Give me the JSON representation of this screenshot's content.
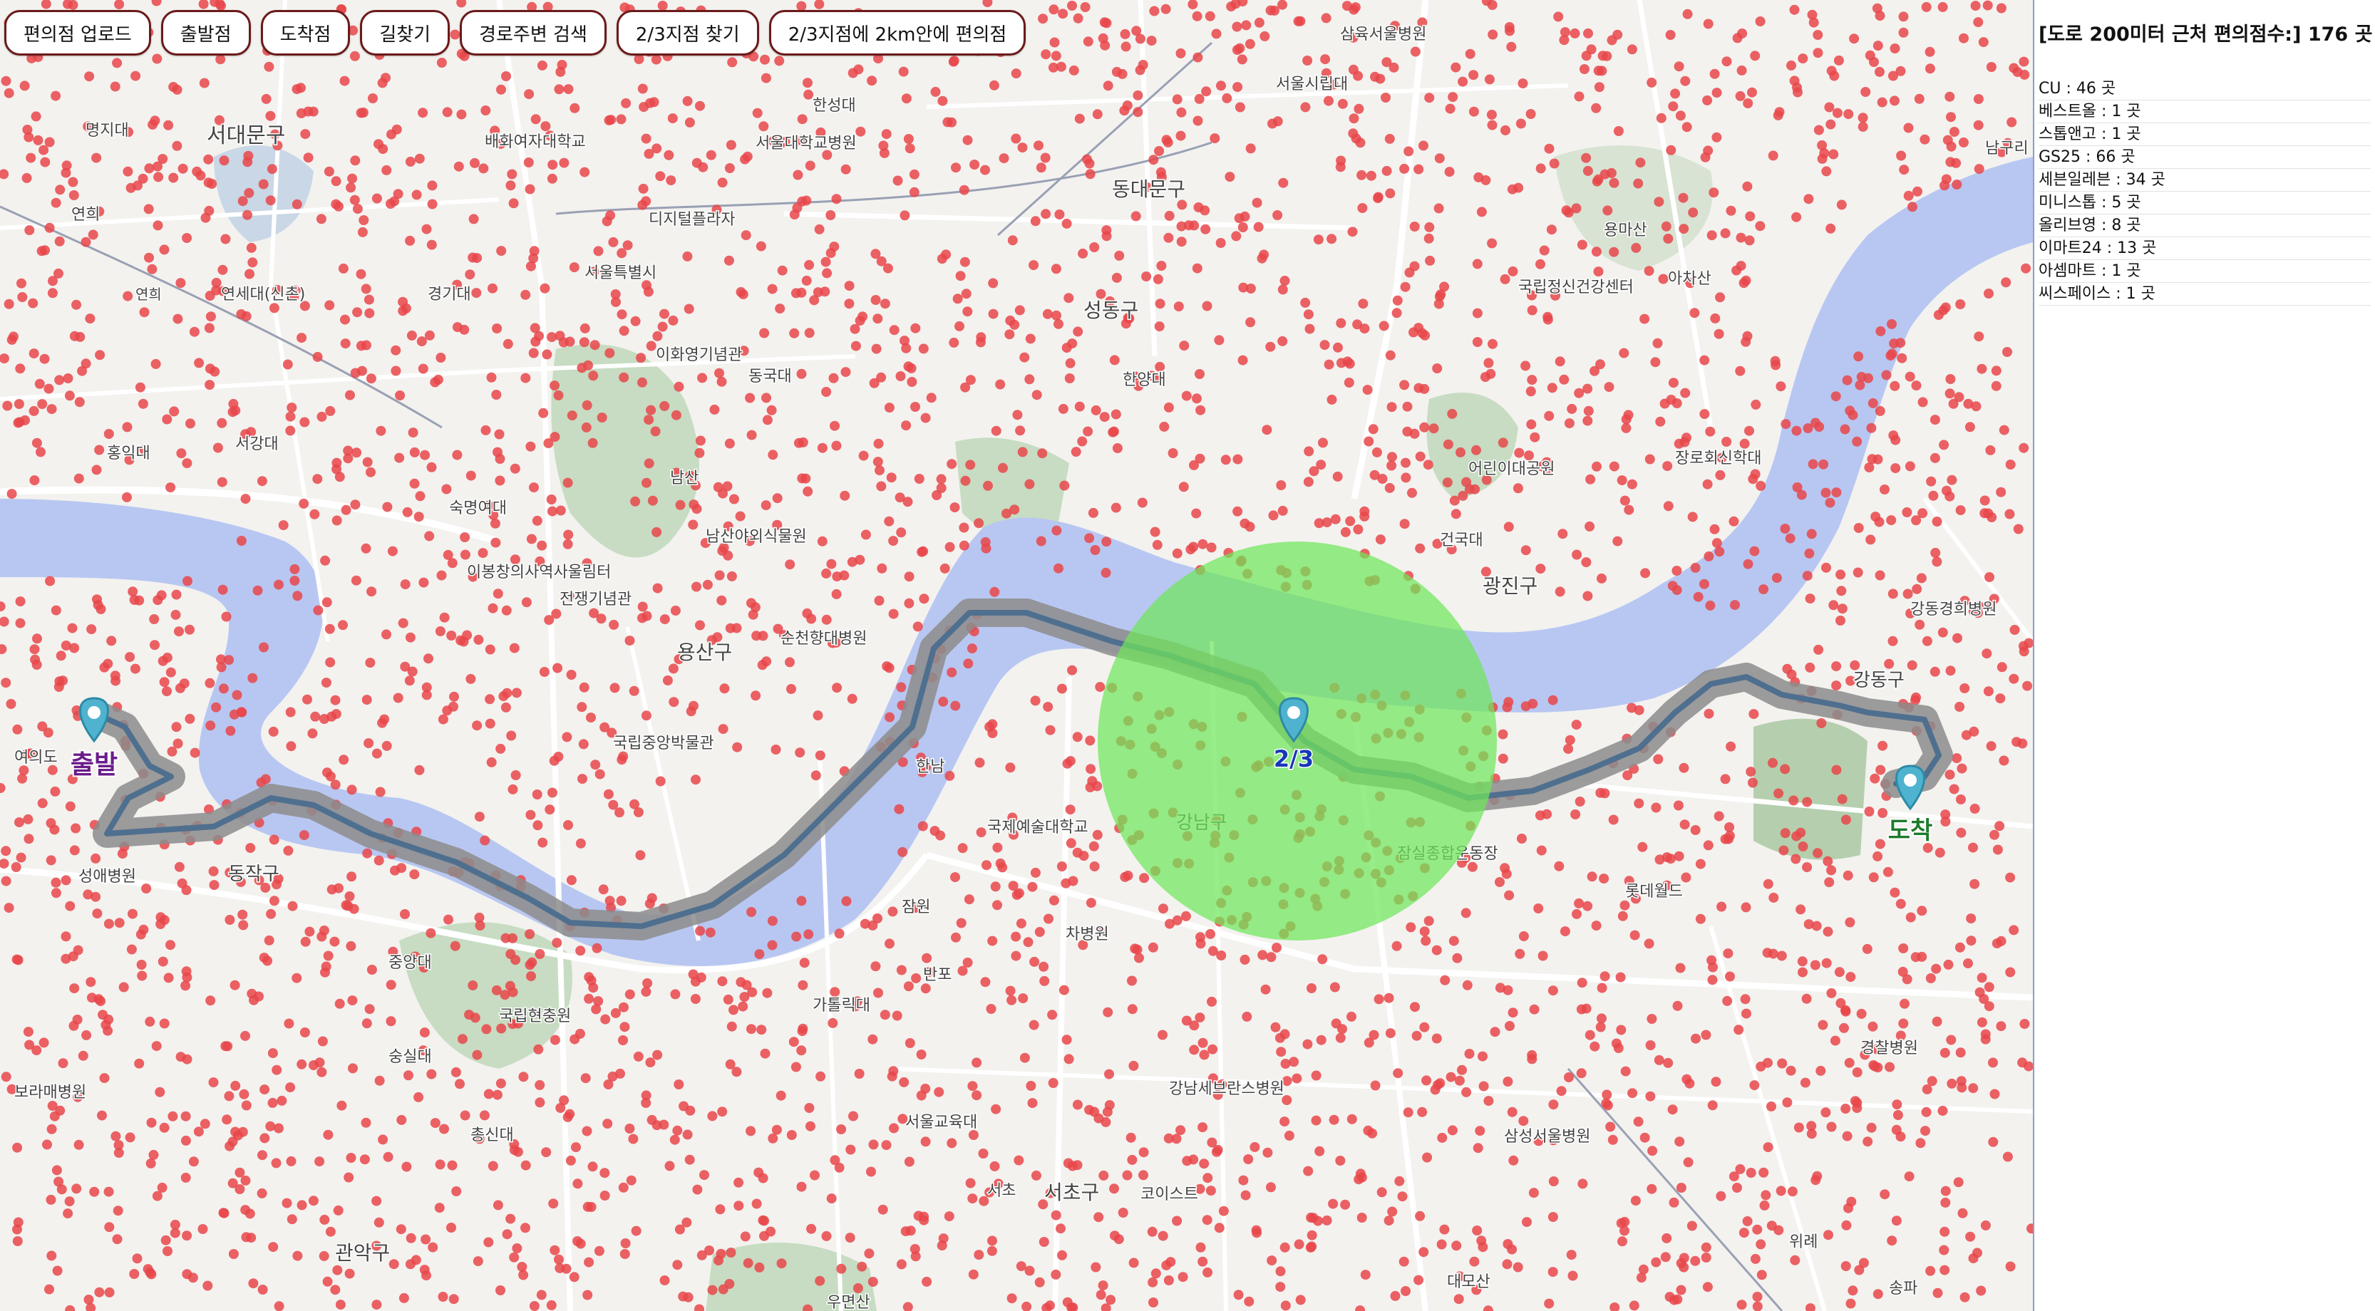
{
  "toolbar": {
    "buttons": [
      {
        "label": "편의점 업로드"
      },
      {
        "label": "출발점"
      },
      {
        "label": "도착점"
      },
      {
        "label": "길찾기"
      },
      {
        "label": "경로주변 검색"
      },
      {
        "label": "2/3지점 찾기"
      },
      {
        "label": "2/3지점에 2km안에 편의점"
      }
    ]
  },
  "panel": {
    "title": "[도로 200미터 근처 편의점수:] 176 곳",
    "stats": [
      {
        "text": "CU : 46 곳"
      },
      {
        "text": "베스트올 : 1 곳"
      },
      {
        "text": "스톱앤고 : 1 곳"
      },
      {
        "text": "GS25 : 66 곳"
      },
      {
        "text": "세븐일레븐 : 34 곳"
      },
      {
        "text": "미니스톱 : 5 곳"
      },
      {
        "text": "올리브영 : 8 곳"
      },
      {
        "text": "이마트24 : 13 곳"
      },
      {
        "text": "아셈마트 : 1 곳"
      },
      {
        "text": "씨스페이스 : 1 곳"
      }
    ]
  },
  "map": {
    "markers": {
      "start": {
        "label": "출발"
      },
      "two_thirds": {
        "label": "2/3"
      },
      "end": {
        "label": "도착"
      }
    },
    "places": [
      {
        "name": "서대문구"
      },
      {
        "name": "명지대"
      },
      {
        "name": "연희"
      },
      {
        "name": "연세대(신촌)"
      },
      {
        "name": "연희"
      },
      {
        "name": "배화여자대학교"
      },
      {
        "name": "한성대"
      },
      {
        "name": "서울대학교병원"
      },
      {
        "name": "삼육서울병원"
      },
      {
        "name": "서울시립대"
      },
      {
        "name": "동대문구"
      },
      {
        "name": "디지털플라자"
      },
      {
        "name": "서울특별시"
      },
      {
        "name": "경기대"
      },
      {
        "name": "이화영기념관"
      },
      {
        "name": "동국대"
      },
      {
        "name": "성동구"
      },
      {
        "name": "한양대"
      },
      {
        "name": "용마산"
      },
      {
        "name": "아차산"
      },
      {
        "name": "국립정신건강센터"
      },
      {
        "name": "서강대"
      },
      {
        "name": "홍익대"
      },
      {
        "name": "숙명여대"
      },
      {
        "name": "남산"
      },
      {
        "name": "남산야외식물원"
      },
      {
        "name": "어린이대공원"
      },
      {
        "name": "건국대"
      },
      {
        "name": "장로회신학대"
      },
      {
        "name": "광진구"
      },
      {
        "name": "이봉창의사역사울림터"
      },
      {
        "name": "전쟁기념관"
      },
      {
        "name": "용산구"
      },
      {
        "name": "순천향대병원"
      },
      {
        "name": "국립중앙박물관"
      },
      {
        "name": "강동경희병원"
      },
      {
        "name": "강동구"
      },
      {
        "name": "여의도"
      },
      {
        "name": "한남"
      },
      {
        "name": "국제예술대학교"
      },
      {
        "name": "강남구"
      },
      {
        "name": "잠실종합운동장"
      },
      {
        "name": "롯데월드"
      },
      {
        "name": "성애병원"
      },
      {
        "name": "동작구"
      },
      {
        "name": "잠원"
      },
      {
        "name": "반포"
      },
      {
        "name": "차병원"
      },
      {
        "name": "중앙대"
      },
      {
        "name": "국립현충원"
      },
      {
        "name": "가톨릭대"
      },
      {
        "name": "경찰병원"
      },
      {
        "name": "숭실대"
      },
      {
        "name": "강남세브란스병원"
      },
      {
        "name": "보라매병원"
      },
      {
        "name": "총신대"
      },
      {
        "name": "서울교육대"
      },
      {
        "name": "삼성서울병원"
      },
      {
        "name": "서초"
      },
      {
        "name": "서초구"
      },
      {
        "name": "코이스트"
      },
      {
        "name": "위례"
      },
      {
        "name": "관악구"
      },
      {
        "name": "대모산"
      },
      {
        "name": "송파"
      },
      {
        "name": "우면산"
      },
      {
        "name": "남구리"
      }
    ]
  },
  "colors": {
    "river": "#b8c7f2",
    "route": "#8c8c8c",
    "route_center": "#4f6f8f",
    "circle": "#6fe65a",
    "dot": "#e8474a",
    "marker": "#4fb3d0",
    "park": "#c7dcc2"
  }
}
